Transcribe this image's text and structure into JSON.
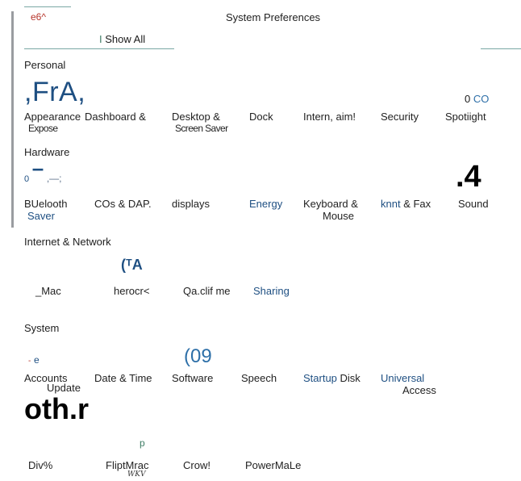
{
  "window": {
    "corner_label": "e6^",
    "title": "System Preferences",
    "toolbar": {
      "show_all_prefix": "I",
      "show_all": "Show All"
    }
  },
  "sections": {
    "personal": {
      "title": "Personal",
      "glyph_left": ",FrA,",
      "glyph_right_prefix": "0",
      "glyph_right_blue": "CO",
      "items": [
        {
          "label": "Appearance",
          "sub": ""
        },
        {
          "label": "Dashboard &",
          "sub": "Expose"
        },
        {
          "label": "Desktop &",
          "sub": "Screen Saver"
        },
        {
          "label": "Dock",
          "sub": ""
        },
        {
          "label": "Intern, aim!",
          "sub": ""
        },
        {
          "label": "Security",
          "sub": ""
        },
        {
          "label": "Spotiight",
          "sub": ""
        }
      ]
    },
    "hardware": {
      "title": "Hardware",
      "glyph_left_a": "0",
      "glyph_left_b": "–",
      "glyph_left_c": ",—;",
      "glyph_right": ".4",
      "items": [
        {
          "label": "BUelooth",
          "sub": "Saver"
        },
        {
          "label": "COs & DAP.",
          "sub": ""
        },
        {
          "label": "displays",
          "sub": ""
        },
        {
          "label": "Energy",
          "sub": ""
        },
        {
          "label": "Keyboard &",
          "sub": "Mouse"
        },
        {
          "label_blue": "knnt",
          "label_rest": " & Fax",
          "sub": ""
        },
        {
          "label": "Sound",
          "sub": ""
        }
      ]
    },
    "internet": {
      "title": "Internet & Network",
      "glyph": "(ᵀA",
      "items": [
        {
          "label": "_Mac"
        },
        {
          "label": "herocr<"
        },
        {
          "label": "Qa.clif me"
        },
        {
          "label": "Sharing"
        }
      ]
    },
    "system": {
      "title": "System",
      "glyph_left_red": "-",
      "glyph_left_blue": "e",
      "glyph_mid": "(09",
      "items": [
        {
          "label": "Accounts",
          "sub": "Update"
        },
        {
          "label": "Date & Time",
          "sub": ""
        },
        {
          "label": "Software",
          "sub": ""
        },
        {
          "label": "Speech",
          "sub": ""
        },
        {
          "label_blue": "Startup",
          "label_rest": " Disk",
          "sub": ""
        },
        {
          "label": "Universal",
          "sub": "Access"
        }
      ]
    },
    "other": {
      "title": "oth.r",
      "glyph": "p",
      "items": [
        {
          "label": "Div%",
          "sub": ""
        },
        {
          "label": "FliptMrac",
          "sub": "WKV"
        },
        {
          "label": "Crow!",
          "sub": ""
        },
        {
          "label": "PowerMaLe",
          "sub": ""
        }
      ]
    }
  }
}
